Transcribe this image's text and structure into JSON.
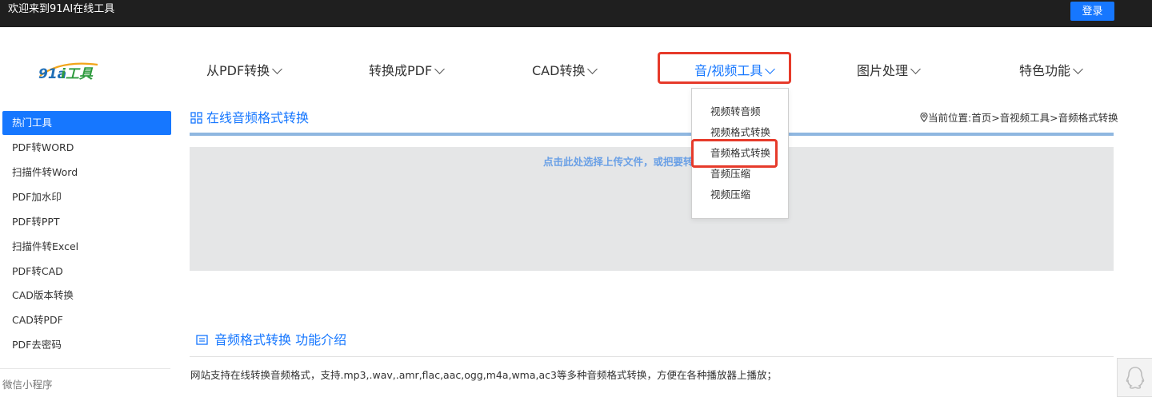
{
  "topbar": {
    "welcome": "欢迎来到91AI在线工具",
    "login": "登录"
  },
  "logo": {
    "text": "91ai工具"
  },
  "nav": [
    {
      "label": "从PDF转换"
    },
    {
      "label": "转换成PDF"
    },
    {
      "label": "CAD转换"
    },
    {
      "label": "音/视频工具",
      "active": true
    },
    {
      "label": "图片处理"
    },
    {
      "label": "特色功能"
    }
  ],
  "dropdown": [
    "视频转音频",
    "视频格式转换",
    "音频格式转换",
    "音频压缩",
    "视频压缩"
  ],
  "sidebar": {
    "items": [
      "热门工具",
      "PDF转WORD",
      "扫描件转Word",
      "PDF加水印",
      "PDF转PPT",
      "扫描件转Excel",
      "PDF转CAD",
      "CAD版本转换",
      "CAD转PDF",
      "PDF去密码"
    ],
    "mini_program": "微信小程序"
  },
  "section": {
    "title": "在线音频格式转换",
    "breadcrumb": "当前位置:首页>音视频工具>音频格式转换"
  },
  "upload": {
    "hint": "点击此处选择上传文件，或把要转"
  },
  "intro": {
    "title": "音频格式转换 功能介绍",
    "text": "网站支持在线转换音频格式，支持.mp3,.wav,.amr,flac,aac,ogg,m4a,wma,ac3等多种音频格式转换，方便在各种播放器上播放；"
  },
  "colors": {
    "accent": "#1677ff",
    "highlight": "#e63a2a",
    "topbar": "#1f1f1f"
  }
}
